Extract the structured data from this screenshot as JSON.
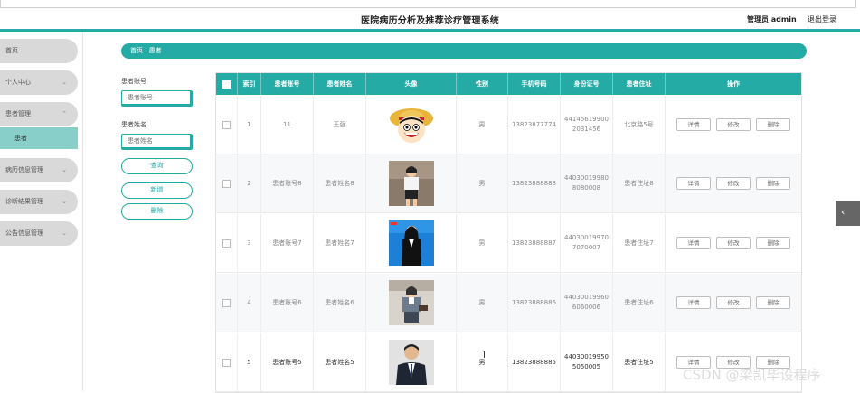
{
  "header": {
    "title": "医院病历分析及推荐诊疗管理系统",
    "admin": "管理员 admin",
    "logout": "退出登录"
  },
  "sidebar": {
    "items": [
      {
        "label": "首页"
      },
      {
        "label": "个人中心",
        "chevron": "⌄"
      },
      {
        "label": "患者管理",
        "chevron": "⌃",
        "sub": "患者"
      },
      {
        "label": "病历信息管理",
        "chevron": "⌄"
      },
      {
        "label": "诊断结果管理",
        "chevron": "⌄"
      },
      {
        "label": "公告信息管理",
        "chevron": "⌄"
      }
    ]
  },
  "breadcrumb": {
    "text": "首页 ⁝ 患者"
  },
  "search": {
    "account_label": "患者账号",
    "account_placeholder": "患者账号",
    "name_label": "患者姓名",
    "name_placeholder": "患者姓名",
    "query_btn": "查询",
    "add_btn": "新增",
    "delete_btn": "删除"
  },
  "table": {
    "headers": [
      "",
      "索引",
      "患者账号",
      "患者姓名",
      "头像",
      "性别",
      "手机号码",
      "身份证号",
      "患者住址",
      "操作"
    ],
    "ops": [
      "详情",
      "修改",
      "删除"
    ],
    "rows": [
      {
        "idx": "1",
        "account": "11",
        "name": "王强",
        "avatar": "cartoon",
        "gender": "男",
        "phone": "13823877774",
        "id1": "44145619900",
        "id2": "2031456",
        "address": "北京路5号"
      },
      {
        "idx": "2",
        "account": "患者账号8",
        "name": "患者姓名8",
        "avatar": "woman-white",
        "gender": "男",
        "phone": "13823888888",
        "id1": "44030019980",
        "id2": "8080008",
        "address": "患者住址8"
      },
      {
        "idx": "3",
        "account": "患者账号7",
        "name": "患者姓名7",
        "avatar": "woman-dark",
        "gender": "男",
        "phone": "13823888887",
        "id1": "44030019970",
        "id2": "7070007",
        "address": "患者住址7"
      },
      {
        "idx": "4",
        "account": "患者账号6",
        "name": "患者姓名6",
        "avatar": "woman-office",
        "gender": "男",
        "phone": "13823888886",
        "id1": "44030019960",
        "id2": "6060006",
        "address": "患者住址6"
      },
      {
        "idx": "5",
        "account": "患者账号5",
        "name": "患者姓名5",
        "avatar": "man-suit",
        "gender": "男",
        "phone": "13823888885",
        "id1": "44030019950",
        "id2": "5050005",
        "address": "患者住址5"
      }
    ]
  },
  "watermark": "CSDN @梁凯毕设程序",
  "colors": {
    "accent": "#25aba5",
    "sidebar_item": "#d9d9d9",
    "sidebar_active": "#88cfc9"
  }
}
